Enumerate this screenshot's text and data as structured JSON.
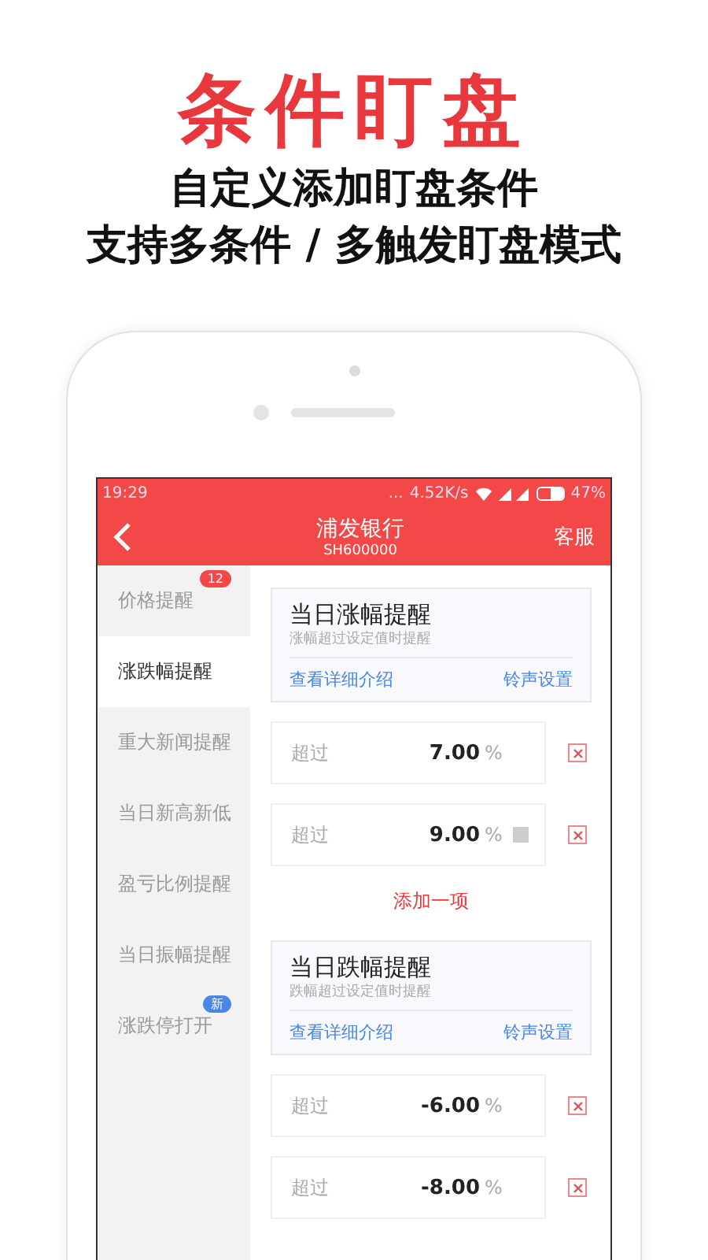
{
  "headline": "条件盯盘",
  "taglines": [
    "自定义添加盯盘条件",
    "支持多条件 / 多触发盯盘模式"
  ],
  "status_bar": {
    "time": "19:29",
    "dots": "...",
    "speed": "4.52K/s",
    "battery": "47%"
  },
  "header": {
    "title": "浦发银行",
    "code": "SH600000",
    "action": "客服"
  },
  "sidebar": {
    "items": [
      {
        "label": "价格提醒",
        "selected": false,
        "badge": {
          "text": "12",
          "color": "#f24848"
        }
      },
      {
        "label": "涨跌幅提醒",
        "selected": true
      },
      {
        "label": "重大新闻提醒",
        "selected": false
      },
      {
        "label": "当日新高新低",
        "selected": false
      },
      {
        "label": "盈亏比例提醒",
        "selected": false
      },
      {
        "label": "当日振幅提醒",
        "selected": false
      },
      {
        "label": "涨跌停打开",
        "selected": false,
        "badge": {
          "text": "新",
          "color": "#4a86e8"
        }
      }
    ]
  },
  "sections": [
    {
      "title": "当日涨幅提醒",
      "subtitle": "涨幅超过设定值时提醒",
      "detail_link": "查看详细介绍",
      "ringtone_link": "铃声设置",
      "rows": [
        {
          "label": "超过",
          "value": "7.00",
          "unit": "%",
          "has_note": false
        },
        {
          "label": "超过",
          "value": "9.00",
          "unit": "%",
          "has_note": true
        }
      ],
      "add_label": "添加一项"
    },
    {
      "title": "当日跌幅提醒",
      "subtitle": "跌幅超过设定值时提醒",
      "detail_link": "查看详细介绍",
      "ringtone_link": "铃声设置",
      "rows": [
        {
          "label": "超过",
          "value": "-6.00",
          "unit": "%",
          "has_note": false
        },
        {
          "label": "超过",
          "value": "-8.00",
          "unit": "%",
          "has_note": false
        }
      ]
    }
  ]
}
